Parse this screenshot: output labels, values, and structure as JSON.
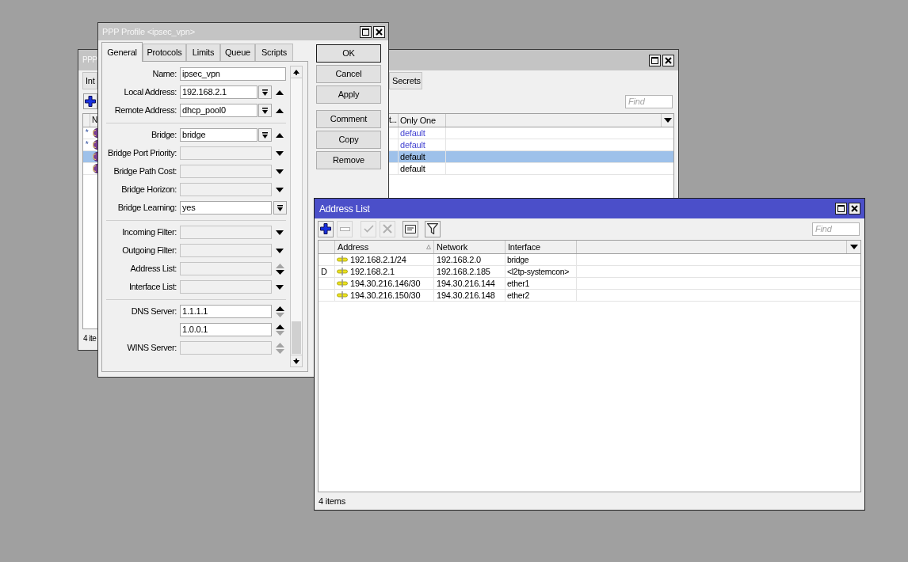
{
  "ppp_window": {
    "title": "PPP",
    "active": false,
    "tabs": [
      "Int",
      "Secrets"
    ],
    "toolbar": [
      {
        "kind": "add",
        "disabled": false
      }
    ],
    "find": {
      "placeholder": "Find"
    },
    "columns": [
      "N",
      "t...",
      "Only One"
    ],
    "rows": [
      {
        "flag": "*",
        "only_one": "default",
        "builtin": true,
        "selected": false
      },
      {
        "flag": "*",
        "only_one": "default",
        "builtin": true,
        "selected": false
      },
      {
        "only_one": "default",
        "builtin": false,
        "selected": true
      },
      {
        "only_one": "default",
        "builtin": false,
        "selected": false
      }
    ],
    "status": "4 ite"
  },
  "profile_dialog": {
    "title": "PPP Profile <ipsec_vpn>",
    "active": false,
    "tabs": [
      {
        "label": "General",
        "selected": true
      },
      {
        "label": "Protocols",
        "selected": false
      },
      {
        "label": "Limits",
        "selected": false
      },
      {
        "label": "Queue",
        "selected": false
      },
      {
        "label": "Scripts",
        "selected": false
      }
    ],
    "groups": [
      [
        {
          "label": "Name:",
          "kind": "text",
          "value": "ipsec_vpn",
          "disabled": false
        },
        {
          "label": "Local Address:",
          "kind": "combo",
          "value": "192.168.2.1",
          "disabled": false
        },
        {
          "label": "Remote Address:",
          "kind": "combo",
          "value": "dhcp_pool0",
          "disabled": false
        }
      ],
      [
        {
          "label": "Bridge:",
          "kind": "combo",
          "value": "bridge",
          "disabled": false
        },
        {
          "label": "Bridge Port Priority:",
          "kind": "expand",
          "disabled": true
        },
        {
          "label": "Bridge Path Cost:",
          "kind": "expand",
          "disabled": true
        },
        {
          "label": "Bridge Horizon:",
          "kind": "expand",
          "disabled": true
        },
        {
          "label": "Bridge Learning:",
          "kind": "select",
          "value": "yes",
          "disabled": false
        }
      ],
      [
        {
          "label": "Incoming Filter:",
          "kind": "expand",
          "disabled": true
        },
        {
          "label": "Outgoing Filter:",
          "kind": "expand",
          "disabled": true
        },
        {
          "label": "Address List:",
          "kind": "list",
          "disabled": true,
          "up_enabled": false,
          "down_enabled": true
        },
        {
          "label": "Interface List:",
          "kind": "expand",
          "disabled": true
        }
      ],
      [
        {
          "label": "DNS Server:",
          "kind": "list",
          "value": "1.1.1.1",
          "disabled": false,
          "up_enabled": true,
          "down_enabled": false
        },
        {
          "kind": "list",
          "value": "1.0.0.1",
          "disabled": false,
          "up_enabled": true,
          "down_enabled": false
        },
        {
          "label": "WINS Server:",
          "kind": "list",
          "disabled": true,
          "up_enabled": false,
          "down_enabled": false
        }
      ]
    ],
    "buttons": [
      [
        {
          "label": "OK",
          "default": true
        },
        {
          "label": "Cancel",
          "default": false
        },
        {
          "label": "Apply",
          "default": false
        }
      ],
      [
        {
          "label": "Comment",
          "default": false
        },
        {
          "label": "Copy",
          "default": false
        },
        {
          "label": "Remove",
          "default": false
        }
      ]
    ]
  },
  "address_list": {
    "title": "Address List",
    "active": true,
    "toolbar": [
      {
        "kind": "add",
        "disabled": false
      },
      {
        "kind": "remove",
        "disabled": true
      },
      {
        "kind": "enable",
        "disabled": true
      },
      {
        "kind": "disable",
        "disabled": true
      },
      {
        "kind": "comment",
        "disabled": false
      },
      {
        "kind": "filter",
        "disabled": false
      }
    ],
    "find": {
      "placeholder": "Find"
    },
    "columns": [
      {
        "label": "Address",
        "sorted": true
      },
      {
        "label": "Network",
        "sorted": false
      },
      {
        "label": "Interface",
        "sorted": false
      }
    ],
    "rows": [
      {
        "address": "192.168.2.1/24",
        "network": "192.168.2.0",
        "interface": "bridge",
        "selected": false
      },
      {
        "flag": "D",
        "address": "192.168.2.1",
        "network": "192.168.2.185",
        "interface": "<l2tp-systemcon>",
        "selected": false
      },
      {
        "address": "194.30.216.146/30",
        "network": "194.30.216.144",
        "interface": "ether1",
        "selected": false
      },
      {
        "address": "194.30.216.150/30",
        "network": "194.30.216.148",
        "interface": "ether2",
        "selected": false
      }
    ],
    "status": "4 items"
  }
}
